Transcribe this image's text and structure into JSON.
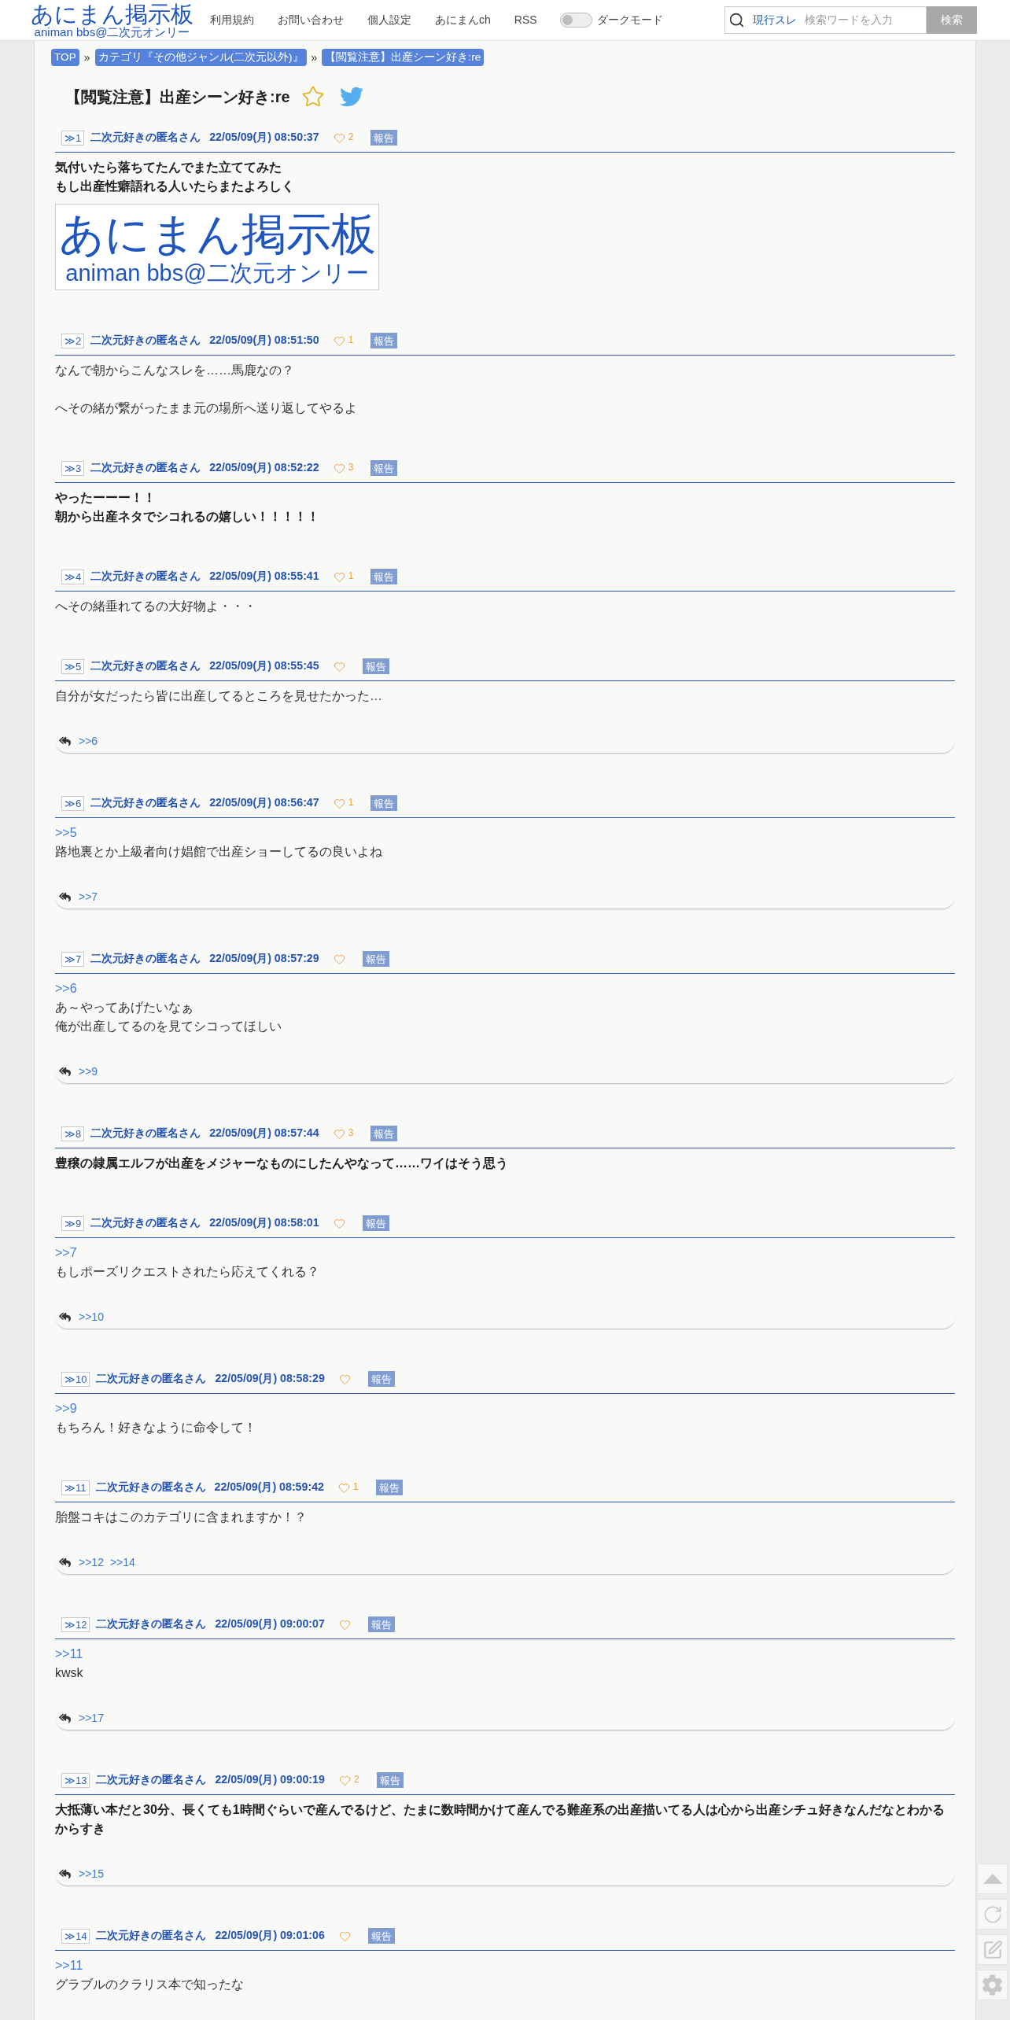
{
  "header": {
    "logo": {
      "title": "あにまん掲示板",
      "subtitle": "animan bbs@二次元オンリー"
    },
    "nav": [
      "利用規約",
      "お問い合わせ",
      "個人設定",
      "あにまんch",
      "RSS"
    ],
    "dark_mode": {
      "label": "ダークモード",
      "on": false
    },
    "search": {
      "scope": "現行スレ",
      "placeholder": "検索ワードを入力",
      "button": "検索"
    }
  },
  "breadcrumb": {
    "items": [
      "TOP",
      "カテゴリ『その他ジャンル(二次元以外)』",
      "【閲覧注意】出産シーン好き:re"
    ],
    "separators": [
      "»",
      "»"
    ]
  },
  "thread": {
    "title": "【閲覧注意】出産シーン好き:re",
    "favorite": false
  },
  "posts": [
    {
      "anchor": "≫1",
      "name": "二次元好きの匿名さん",
      "date": "22/05/09(月) 08:50:37",
      "likes": "2",
      "report": "報告",
      "emphasized": true,
      "paragraphs": [
        [
          "気付いたら落ちてたんでまた立ててみた",
          "もし出産性癖語れる人いたらまたよろしく"
        ]
      ],
      "image": {
        "title": "あにまん掲示板",
        "subtitle": "animan bbs@二次元オンリー"
      }
    },
    {
      "anchor": "≫2",
      "name": "二次元好きの匿名さん",
      "date": "22/05/09(月) 08:51:50",
      "likes": "1",
      "report": "報告",
      "emphasized": false,
      "paragraphs": [
        [
          "なんで朝からこんなスレを……馬鹿なの？"
        ],
        [
          "へその緒が繋がったまま元の場所へ送り返してやるよ"
        ]
      ]
    },
    {
      "anchor": "≫3",
      "name": "二次元好きの匿名さん",
      "date": "22/05/09(月) 08:52:22",
      "likes": "3",
      "report": "報告",
      "emphasized": true,
      "paragraphs": [
        [
          "やったーーー！！",
          "朝から出産ネタでシコれるの嬉しい！！！！！"
        ]
      ]
    },
    {
      "anchor": "≫4",
      "name": "二次元好きの匿名さん",
      "date": "22/05/09(月) 08:55:41",
      "likes": "1",
      "report": "報告",
      "emphasized": false,
      "paragraphs": [
        [
          "へその緒垂れてるの大好物よ・・・"
        ]
      ]
    },
    {
      "anchor": "≫5",
      "name": "二次元好きの匿名さん",
      "date": "22/05/09(月) 08:55:45",
      "report": "報告",
      "emphasized": false,
      "paragraphs": [
        [
          "自分が女だったら皆に出産してるところを見せたかった…"
        ]
      ],
      "replies": [
        ">>6"
      ]
    },
    {
      "anchor": "≫6",
      "name": "二次元好きの匿名さん",
      "date": "22/05/09(月) 08:56:47",
      "likes": "1",
      "report": "報告",
      "emphasized": false,
      "quote": ">>5",
      "paragraphs": [
        [
          "路地裏とか上級者向け娼館で出産ショーしてるの良いよね"
        ]
      ],
      "replies": [
        ">>7"
      ]
    },
    {
      "anchor": "≫7",
      "name": "二次元好きの匿名さん",
      "date": "22/05/09(月) 08:57:29",
      "report": "報告",
      "emphasized": false,
      "quote": ">>6",
      "paragraphs": [
        [
          "あ～やってあげたいなぁ",
          "俺が出産してるのを見てシコってほしい"
        ]
      ],
      "replies": [
        ">>9"
      ]
    },
    {
      "anchor": "≫8",
      "name": "二次元好きの匿名さん",
      "date": "22/05/09(月) 08:57:44",
      "likes": "3",
      "report": "報告",
      "emphasized": true,
      "paragraphs": [
        [
          "豊穣の隷属エルフが出産をメジャーなものにしたんやなって……ワイはそう思う"
        ]
      ]
    },
    {
      "anchor": "≫9",
      "name": "二次元好きの匿名さん",
      "date": "22/05/09(月) 08:58:01",
      "report": "報告",
      "emphasized": false,
      "quote": ">>7",
      "paragraphs": [
        [
          "もしポーズリクエストされたら応えてくれる？"
        ]
      ],
      "replies": [
        ">>10"
      ]
    },
    {
      "anchor": "≫10",
      "name": "二次元好きの匿名さん",
      "date": "22/05/09(月) 08:58:29",
      "report": "報告",
      "emphasized": false,
      "quote": ">>9",
      "paragraphs": [
        [
          "もちろん！好きなように命令して！"
        ]
      ]
    },
    {
      "anchor": "≫11",
      "name": "二次元好きの匿名さん",
      "date": "22/05/09(月) 08:59:42",
      "likes": "1",
      "report": "報告",
      "emphasized": false,
      "paragraphs": [
        [
          "胎盤コキはこのカテゴリに含まれますか！？"
        ]
      ],
      "replies": [
        ">>12",
        ">>14"
      ]
    },
    {
      "anchor": "≫12",
      "name": "二次元好きの匿名さん",
      "date": "22/05/09(月) 09:00:07",
      "report": "報告",
      "emphasized": false,
      "quote": ">>11",
      "paragraphs": [
        [
          "kwsk"
        ]
      ],
      "replies": [
        ">>17"
      ]
    },
    {
      "anchor": "≫13",
      "name": "二次元好きの匿名さん",
      "date": "22/05/09(月) 09:00:19",
      "likes": "2",
      "report": "報告",
      "emphasized": true,
      "paragraphs": [
        [
          "大抵薄い本だと30分、長くても1時間ぐらいで産んでるけど、たまに数時間かけて産んでる難産系の出産描いてる人は心から出産シチュ好きなんだなとわかるからすき"
        ]
      ],
      "replies": [
        ">>15"
      ]
    },
    {
      "anchor": "≫14",
      "name": "二次元好きの匿名さん",
      "date": "22/05/09(月) 09:01:06",
      "report": "報告",
      "emphasized": false,
      "quote": ">>11",
      "paragraphs": [
        [
          "グラブルのクラリス本で知ったな"
        ]
      ]
    }
  ]
}
